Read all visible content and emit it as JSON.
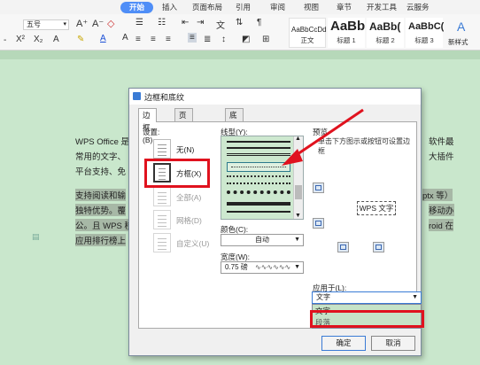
{
  "ribbon": {
    "tabs": [
      "开始",
      "插入",
      "页面布局",
      "引用",
      "审阅",
      "视图",
      "章节",
      "开发工具",
      "云服务"
    ],
    "font_size": "五号",
    "styles": [
      {
        "sample": "AaBbCcDd",
        "name": "正文"
      },
      {
        "sample": "AaBb",
        "name": "标题 1"
      },
      {
        "sample": "AaBb(",
        "name": "标题 2"
      },
      {
        "sample": "AaBbC(",
        "name": "标题 3"
      },
      {
        "sample": "A",
        "name": "新样式"
      }
    ]
  },
  "document": {
    "lines": [
      {
        "left": "WPS Office 是",
        "right": "软件最"
      },
      {
        "left": "常用的文字、",
        "right": "大插件"
      },
      {
        "left": "平台支持、免",
        "right": ""
      },
      {
        "left": "支持阅读和输",
        "right": "ptx 等）"
      },
      {
        "left": "独特优势。覆",
        "right": "移动办"
      },
      {
        "left": "公。且 WPS 移",
        "right": "roid 在"
      },
      {
        "left": "应用排行榜上",
        "right": ""
      }
    ]
  },
  "dialog": {
    "title": "边框和底纹",
    "tabs": [
      "边框(B)",
      "页面边框(P)",
      "底纹(S)"
    ],
    "settings_label": "设置:",
    "settings": [
      "无(N)",
      "方框(X)",
      "全部(A)",
      "网格(D)",
      "自定义(U)"
    ],
    "line_style_label": "线型(Y):",
    "color_label": "颜色(C):",
    "color_value": "自动",
    "width_label": "宽度(W):",
    "width_value": "0.75 磅",
    "preview_label": "预览",
    "preview_hint": "单击下方图示或按钮可设置边框",
    "preview_text": "WPS 文字",
    "apply_label": "应用于(L):",
    "apply_value": "文字",
    "apply_options": [
      "文字",
      "段落"
    ],
    "ok": "确定",
    "cancel": "取消"
  },
  "colors": {
    "highlight": "#e0121e",
    "accent": "#4f8ef7"
  }
}
